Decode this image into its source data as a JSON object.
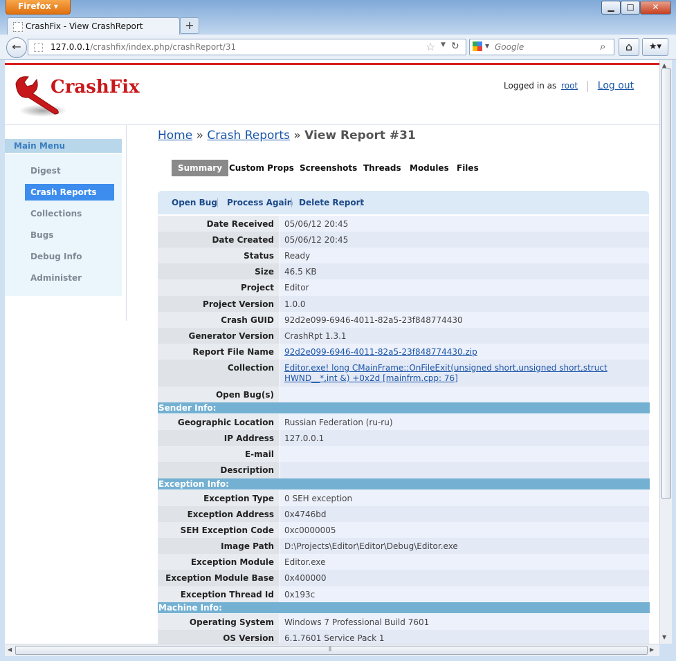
{
  "browser": {
    "app_button": "Firefox",
    "tab_title": "CrashFix - View CrashReport",
    "url_host": "127.0.0.1",
    "url_path": "/crashfix/index.php/crashReport/31",
    "search_placeholder": "Google",
    "window_buttons": {
      "minimize": "▁",
      "maximize": "□",
      "close": "✕"
    }
  },
  "header": {
    "logo_text": "CrashFix",
    "logged_in_prefix": "Logged in as",
    "username": "root",
    "logout": "Log out"
  },
  "sidebar": {
    "title": "Main Menu",
    "items": [
      {
        "label": "Digest"
      },
      {
        "label": "Crash Reports"
      },
      {
        "label": "Collections"
      },
      {
        "label": "Bugs"
      },
      {
        "label": "Debug Info"
      },
      {
        "label": "Administer"
      }
    ],
    "active_index": 1
  },
  "breadcrumb": {
    "home": "Home",
    "sep": "»",
    "crash_reports": "Crash Reports",
    "current": "View Report #31"
  },
  "tabs": [
    "Summary",
    "Custom Props",
    "Screenshots",
    "Threads",
    "Modules",
    "Files"
  ],
  "actions": [
    "Open Bug",
    "Process Again",
    "Delete Report"
  ],
  "report": [
    {
      "label": "Date Received",
      "value": "05/06/12 20:45"
    },
    {
      "label": "Date Created",
      "value": "05/06/12 20:45"
    },
    {
      "label": "Status",
      "value": "Ready"
    },
    {
      "label": "Size",
      "value": "46.5 KB"
    },
    {
      "label": "Project",
      "value": "Editor"
    },
    {
      "label": "Project Version",
      "value": "1.0.0"
    },
    {
      "label": "Crash GUID",
      "value": "92d2e099-6946-4011-82a5-23f848774430"
    },
    {
      "label": "Generator Version",
      "value": "CrashRpt 1.3.1"
    },
    {
      "label": "Report File Name",
      "value": "92d2e099-6946-4011-82a5-23f848774430.zip"
    },
    {
      "label": "Collection",
      "value": "Editor.exe! long CMainFrame::OnFileExit(unsigned short,unsigned short,struct HWND__*,int &) +0x2d [mainfrm.cpp: 76]"
    },
    {
      "label": "Open Bug(s)",
      "value": ""
    }
  ],
  "sender_title": "Sender Info:",
  "sender": [
    {
      "label": "Geographic Location",
      "value": "Russian Federation (ru-ru)"
    },
    {
      "label": "IP Address",
      "value": "127.0.0.1"
    },
    {
      "label": "E-mail",
      "value": ""
    },
    {
      "label": "Description",
      "value": ""
    }
  ],
  "exception_title": "Exception Info:",
  "exception": [
    {
      "label": "Exception Type",
      "value": "0 SEH exception"
    },
    {
      "label": "Exception Address",
      "value": "0x4746bd"
    },
    {
      "label": "SEH Exception Code",
      "value": "0xc0000005"
    },
    {
      "label": "Image Path",
      "value": "D:\\Projects\\Editor\\Editor\\Debug\\Editor.exe"
    },
    {
      "label": "Exception Module",
      "value": "Editor.exe"
    },
    {
      "label": "Exception Module Base",
      "value": "0x400000"
    },
    {
      "label": "Exception Thread Id",
      "value": "0x193c"
    }
  ],
  "machine_title": "Machine Info:",
  "machine": [
    {
      "label": "Operating System",
      "value": "Windows 7 Professional Build 7601"
    },
    {
      "label": "OS Version",
      "value": "6.1.7601 Service Pack 1"
    }
  ],
  "colors": {
    "accent_red": "#d62020",
    "link": "#1a55a8",
    "section_header": "#73b0d2",
    "menu_active": "#3d8dee"
  }
}
